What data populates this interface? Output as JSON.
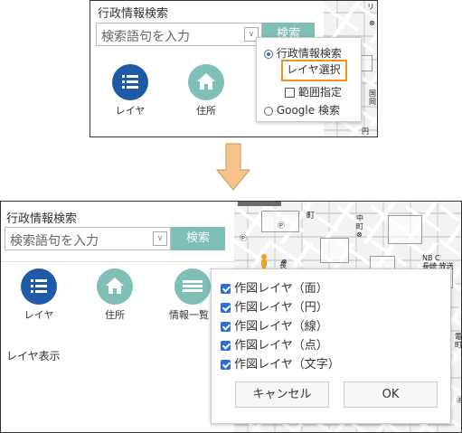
{
  "top": {
    "title": "行政情報検索",
    "search_placeholder": "検索語句を入力",
    "search_button": "検索",
    "icons": {
      "layer": "レイヤ",
      "address": "住所"
    },
    "popup": {
      "options": [
        {
          "label": "行政情報検索",
          "type": "radio",
          "selected": true
        },
        {
          "label": "レイヤ選択",
          "type": "sub",
          "highlighted": true
        },
        {
          "label": "範囲指定",
          "type": "checkbox",
          "checked": false
        },
        {
          "label": "Google 検索",
          "type": "radio",
          "selected": false
        }
      ]
    }
  },
  "arrow_color": "#f6c48a",
  "highlight_color": "#f0921e",
  "bottom": {
    "title": "行政情報検索",
    "search_placeholder": "検索語句を入力",
    "search_button": "検索",
    "icons": {
      "layer": "レイヤ",
      "address": "住所",
      "list": "情報一覧"
    },
    "layer_display": "レイヤ表示",
    "dialog": {
      "items": [
        {
          "label": "作図レイヤ（面）",
          "checked": true
        },
        {
          "label": "作図レイヤ（円）",
          "checked": true
        },
        {
          "label": "作図レイヤ（線）",
          "checked": true
        },
        {
          "label": "作図レイヤ（点）",
          "checked": true
        },
        {
          "label": "作図レイヤ（文字）",
          "checked": true
        }
      ],
      "cancel": "キャンセル",
      "ok": "OK"
    }
  }
}
